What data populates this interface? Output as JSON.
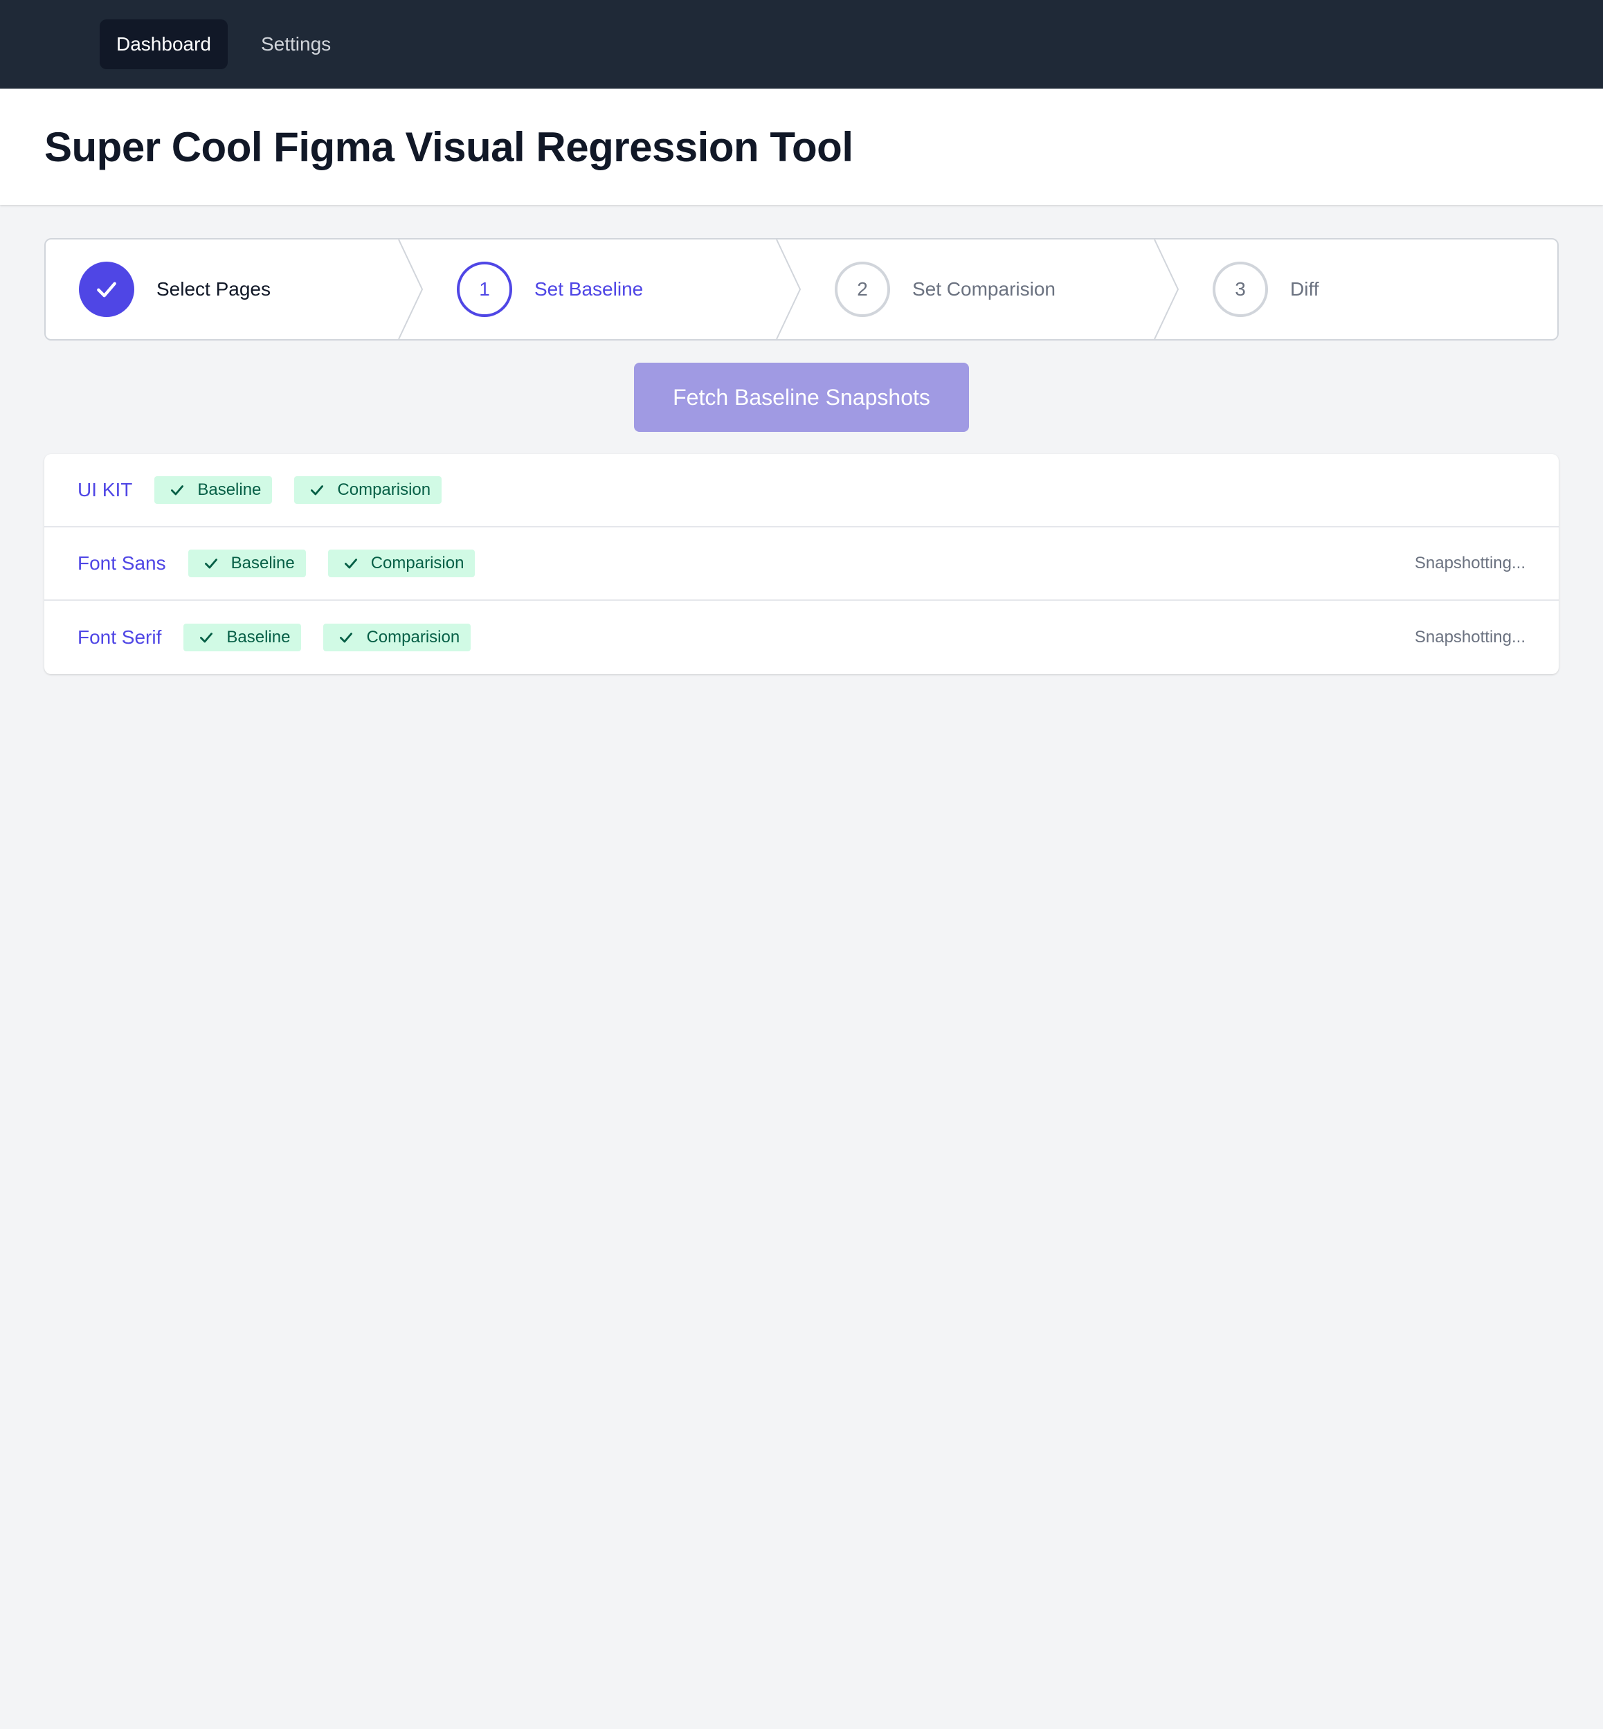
{
  "nav": {
    "items": [
      {
        "label": "Dashboard",
        "active": true
      },
      {
        "label": "Settings",
        "active": false
      }
    ]
  },
  "header": {
    "title": "Super Cool Figma Visual Regression Tool"
  },
  "stepper": {
    "steps": [
      {
        "label": "Select Pages",
        "number": "",
        "state": "done",
        "icon": "check-icon"
      },
      {
        "label": "Set Baseline",
        "number": "1",
        "state": "current"
      },
      {
        "label": "Set Comparision",
        "number": "2",
        "state": "upcoming"
      },
      {
        "label": "Diff",
        "number": "3",
        "state": "upcoming"
      }
    ]
  },
  "actions": {
    "fetch_label": "Fetch Baseline Snapshots"
  },
  "pages": [
    {
      "name": "UI KIT",
      "badges": [
        {
          "label": "Baseline",
          "icon": "check-icon"
        },
        {
          "label": "Comparision",
          "icon": "check-icon"
        }
      ],
      "status": ""
    },
    {
      "name": "Font Sans",
      "badges": [
        {
          "label": "Baseline",
          "icon": "check-icon"
        },
        {
          "label": "Comparision",
          "icon": "check-icon"
        }
      ],
      "status": "Snapshotting..."
    },
    {
      "name": "Font Serif",
      "badges": [
        {
          "label": "Baseline",
          "icon": "check-icon"
        },
        {
          "label": "Comparision",
          "icon": "check-icon"
        }
      ],
      "status": "Snapshotting..."
    }
  ],
  "colors": {
    "nav_bg": "#1f2937",
    "accent": "#4f46e5",
    "badge_bg": "#d1fae5",
    "badge_text": "#065f46",
    "button_bg": "#a09ae3"
  }
}
